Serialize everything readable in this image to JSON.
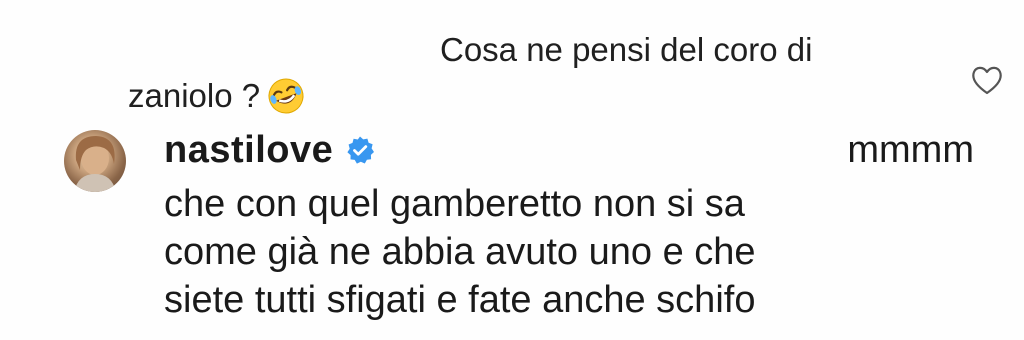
{
  "parent_comment": {
    "line1": "Cosa ne pensi del coro di",
    "line2": "zaniolo ?",
    "emoji": "rolling-on-the-floor-laughing-emoji"
  },
  "reply": {
    "username": "nastilove",
    "verified": true,
    "inline_text": "mmmm",
    "lines": [
      "che con quel gamberetto non si sa",
      "come già ne abbia avuto uno e che",
      "siete tutti sfigati e fate anche schifo"
    ]
  },
  "icons": {
    "like": "heart-icon",
    "verified": "verified-badge-icon",
    "avatar": "profile-avatar"
  },
  "colors": {
    "verified_blue": "#3897f0",
    "text": "#1a1a1a"
  }
}
